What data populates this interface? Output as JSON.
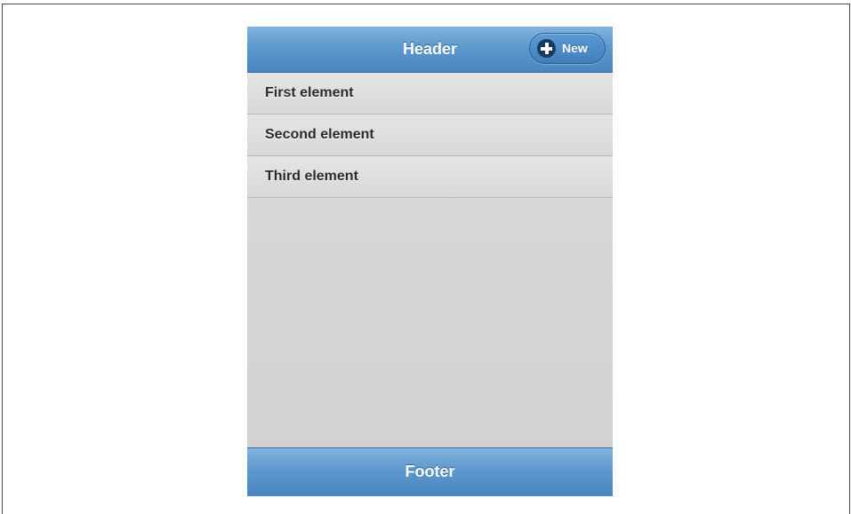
{
  "header": {
    "title": "Header",
    "new_button_label": "New",
    "new_button_icon": "plus-icon"
  },
  "list": {
    "items": [
      {
        "label": "First element"
      },
      {
        "label": "Second element"
      },
      {
        "label": "Third element"
      }
    ]
  },
  "footer": {
    "title": "Footer"
  },
  "colors": {
    "bar_blue": "#5b96cc",
    "content_gray": "#d6d6d6"
  }
}
